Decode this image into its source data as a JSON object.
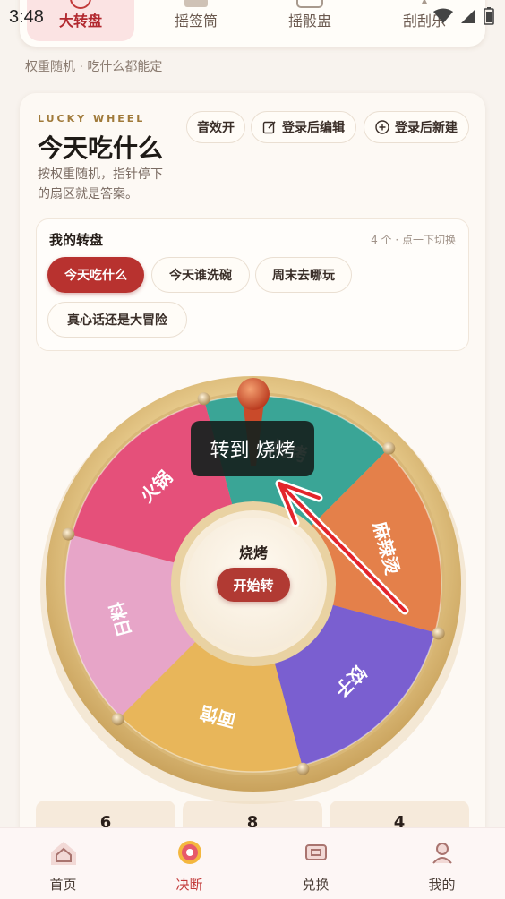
{
  "status_bar": {
    "time": "3:48"
  },
  "top_tabs": [
    {
      "label": "大转盘",
      "active": true
    },
    {
      "label": "摇签筒",
      "active": false
    },
    {
      "label": "摇骰盅",
      "active": false
    },
    {
      "label": "刮刮乐",
      "active": false
    }
  ],
  "subtitle": "权重随机 · 吃什么都能定",
  "card": {
    "eyebrow": "LUCKY WHEEL",
    "title": "今天吃什么",
    "description": "按权重随机，指针停下的扇区就是答案。",
    "sound_button": "音效开",
    "edit_button": "登录后编辑",
    "new_button": "登录后新建"
  },
  "my_wheels": {
    "title": "我的转盘",
    "hint": "4 个 · 点一下切换",
    "chips": [
      "今天吃什么",
      "今天谁洗碗",
      "周末去哪玩",
      "真心话还是大冒险"
    ],
    "active_index": 0
  },
  "wheel": {
    "segments": [
      {
        "label": "烧烤",
        "color": "#3aa596"
      },
      {
        "label": "麻辣烫",
        "color": "#e4804a"
      },
      {
        "label": "饺子",
        "color": "#7a5fd0"
      },
      {
        "label": "面馆",
        "color": "#e8b65a"
      },
      {
        "label": "日料",
        "color": "#e7a5c8"
      },
      {
        "label": "火锅",
        "color": "#e5507a"
      }
    ],
    "result": "烧烤",
    "spin_button": "开始转",
    "tooltip_text": "转到 烧烤"
  },
  "stats": [
    "6",
    "8",
    "4"
  ],
  "bottom_nav": [
    {
      "label": "首页",
      "icon": "home-icon",
      "active": false
    },
    {
      "label": "决断",
      "icon": "wheel-icon",
      "active": true
    },
    {
      "label": "兑换",
      "icon": "ticket-icon",
      "active": false
    },
    {
      "label": "我的",
      "icon": "user-icon",
      "active": false
    }
  ],
  "colors": {
    "accent": "#b8322f",
    "gold": "#d8b26a",
    "background": "#f8f3ee"
  }
}
